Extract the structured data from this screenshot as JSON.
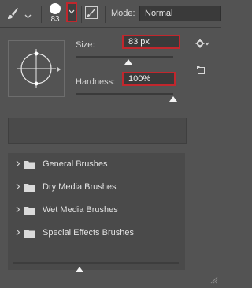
{
  "toolbar": {
    "brush_size_preview": "83",
    "mode_label": "Mode:",
    "mode_value": "Normal"
  },
  "brush_settings": {
    "size_label": "Size:",
    "size_value": "83 px",
    "size_fraction": 0.54,
    "hardness_label": "Hardness:",
    "hardness_value": "100%",
    "hardness_fraction": 1.0
  },
  "brush_groups": [
    {
      "label": "General Brushes"
    },
    {
      "label": "Dry Media Brushes"
    },
    {
      "label": "Wet Media Brushes"
    },
    {
      "label": "Special Effects Brushes"
    }
  ],
  "preview_scale_fraction": 0.4,
  "colors": {
    "highlight": "#c1272d",
    "panel": "#535353",
    "field": "#3a3a3a"
  },
  "icons": [
    "brush-icon",
    "chevron-down-icon",
    "brush-panel-icon",
    "gear-icon",
    "new-preset-icon",
    "folder-icon",
    "chevron-right-icon",
    "resize-grip-icon"
  ]
}
